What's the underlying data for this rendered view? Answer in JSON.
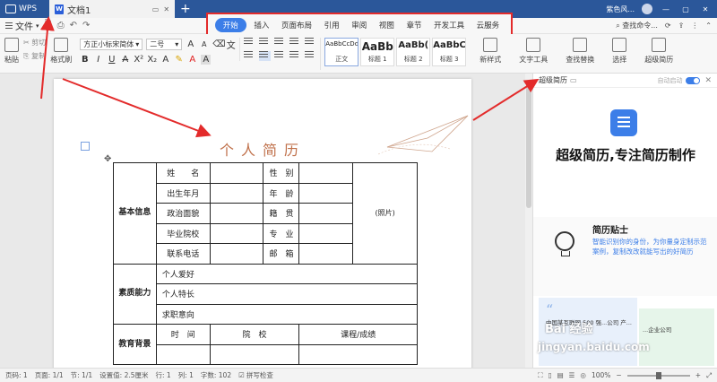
{
  "titlebar": {
    "app": "WPS",
    "doc_tab": "文档1",
    "right_label": "紫色风...",
    "new_tab": "+"
  },
  "menu": {
    "file": "文件",
    "tabs": [
      "开始",
      "插入",
      "页面布局",
      "引用",
      "审阅",
      "视图",
      "章节",
      "开发工具",
      "云服务"
    ],
    "active_tab": "开始",
    "search": "查找命令..."
  },
  "ribbon": {
    "paste": "粘贴",
    "cut": "剪切",
    "copy": "复制",
    "format_painter": "格式刷",
    "font_name": "方正小标宋简体",
    "font_size": "二号",
    "styles": [
      {
        "sample": "AaBbCcDd",
        "name": "正文"
      },
      {
        "sample": "AaBb",
        "name": "标题 1"
      },
      {
        "sample": "AaBb(",
        "name": "标题 2"
      },
      {
        "sample": "AaBbC",
        "name": "标题 3"
      }
    ],
    "new_style": "新样式",
    "text_tools": "文字工具",
    "find_replace": "查找替换",
    "select": "选择",
    "super_resume": "超级简历"
  },
  "document": {
    "title": "个人简历",
    "photo": "(照片)",
    "sections": {
      "basic": "基本信息",
      "quality": "素质能力",
      "education": "教育背景"
    },
    "rows": {
      "name": "姓　　名",
      "gender": "性　别",
      "birth": "出生年月",
      "age": "年　龄",
      "politics": "政治面貌",
      "native": "籍　贯",
      "school": "毕业院校",
      "major": "专　业",
      "phone": "联系电话",
      "email": "邮　箱",
      "hobby": "个人爱好",
      "specialty": "个人特长",
      "intention": "求职意向",
      "edu_time": "时　间",
      "edu_school": "院　校",
      "edu_course": "课程/成绩"
    }
  },
  "panel": {
    "header": "超级简历",
    "auto_start": "自动启动",
    "slogan": "超级简历,专注简历制作",
    "tips_title": "简历贴士",
    "tips_text": "智能识别你的身份，为你量身定制示范案例，复制改改就能写出的好简历",
    "card_a_text": "中国某互联网 500 强...公司 产...",
    "card_b_text": "...企业公司"
  },
  "status": {
    "page": "页码: 1",
    "pages": "页面: 1/1",
    "section": "节: 1/1",
    "position": "设置值: 2.5厘米",
    "line": "行: 1",
    "column": "列: 1",
    "words": "字数: 102",
    "spell": "拼写检查",
    "zoom": "100%"
  },
  "watermark": {
    "line1": "Bai 经验",
    "line2": "jingyan.baidu.com"
  }
}
